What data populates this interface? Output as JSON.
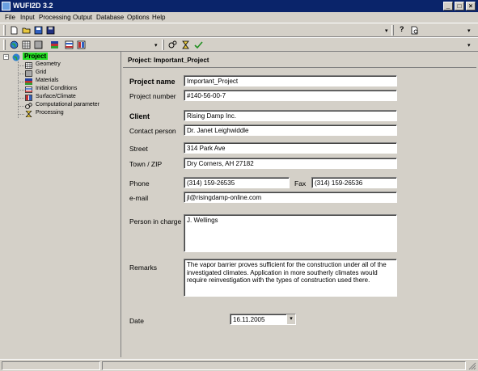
{
  "window": {
    "title": "WUFI2D 3.2"
  },
  "menu": [
    "File",
    "Input",
    "Processing",
    "Output",
    "Database",
    "Options",
    "Help"
  ],
  "toolbar": {
    "help_glyph": "?"
  },
  "tree": {
    "root": "Project",
    "items": [
      "Geometry",
      "Grid",
      "Materials",
      "Initial Conditions",
      "Surface/Climate",
      "Computational parameter",
      "Processing"
    ]
  },
  "project": {
    "header": "Project: Important_Project",
    "labels": {
      "project_name": "Project name",
      "project_number": "Project number",
      "client": "Client",
      "contact_person": "Contact person",
      "street": "Street",
      "town_zip": "Town / ZIP",
      "phone": "Phone",
      "fax": "Fax",
      "email": "e-mail",
      "person_in_charge": "Person in charge",
      "remarks": "Remarks",
      "date": "Date"
    },
    "values": {
      "project_name": "Important_Project",
      "project_number": "#140-56-00-7",
      "client": "Rising Damp Inc.",
      "contact_person": "Dr. Janet Leighwiddle",
      "street": "314 Park Ave",
      "town_zip": "Dry Corners, AH 27182",
      "phone": "(314) 159-26535",
      "fax": "(314) 159-26536",
      "email": "jl@risingdamp-online.com",
      "person_in_charge": "J. Wellings",
      "remarks": "The vapor barrier proves sufficient for the construction under all of the investigated climates. Application in more southerly climates would require reinvestigation with the types of construction used there.",
      "date": "16.11.2005"
    }
  }
}
